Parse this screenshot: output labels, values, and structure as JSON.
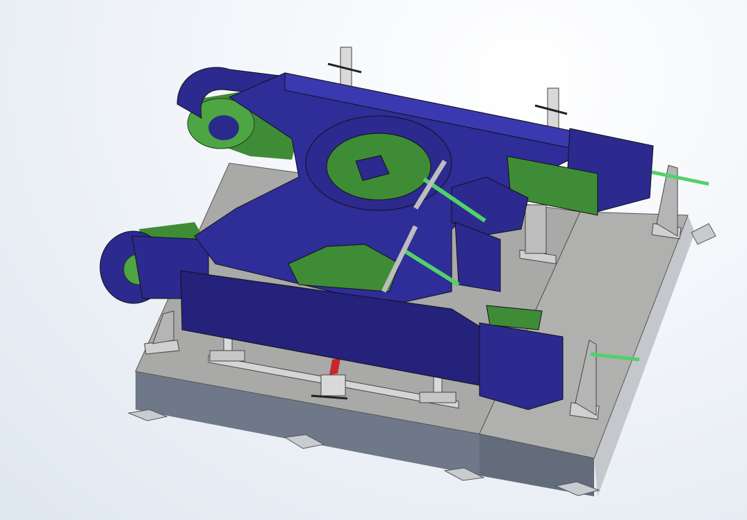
{
  "viewport": {
    "background": "#e9eef4"
  },
  "model": {
    "colors": {
      "frame_blue": "#2c2a8f",
      "frame_blue_dark": "#1c1a63",
      "frame_blue_light": "#3b39b0",
      "part_green": "#3f8c37",
      "part_green_light": "#5bb54c",
      "plate_top": "#a9aaa8",
      "plate_side": "#5d6776",
      "plate_front": "#7a8393",
      "fixture_gray": "#c9c9c9",
      "strap_green": "#52d06b",
      "accent_red": "#c7262b"
    }
  }
}
